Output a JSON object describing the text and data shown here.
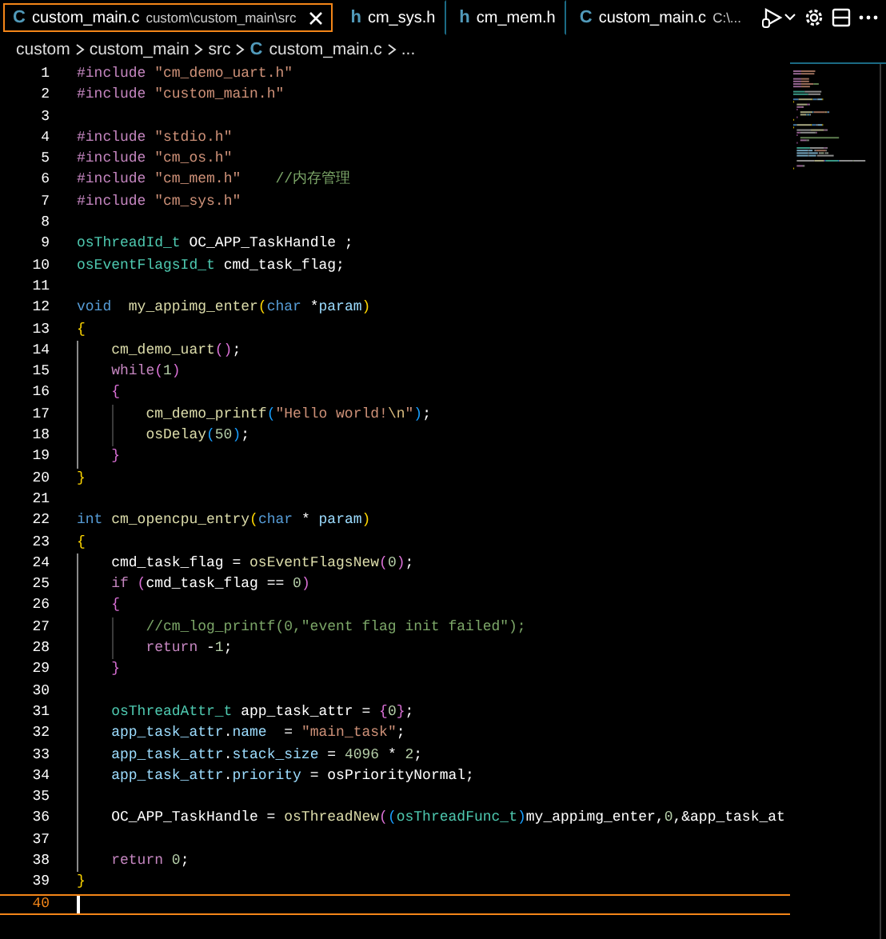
{
  "tabs": [
    {
      "icon": "C",
      "label": "custom_main.c",
      "description": "custom\\custom_main\\src",
      "selected": true
    },
    {
      "icon": "h",
      "label": "cm_sys.h",
      "selected": false
    },
    {
      "icon": "h",
      "label": "cm_mem.h",
      "selected": false
    },
    {
      "icon": "C",
      "label": "custom_main.c",
      "description": "C:\\...",
      "selected": false
    }
  ],
  "breadcrumb": [
    {
      "text": "custom"
    },
    {
      "text": "custom_main"
    },
    {
      "text": "src"
    },
    {
      "text": "custom_main.c",
      "icon": "C"
    },
    {
      "text": "..."
    }
  ],
  "lines": [
    {
      "number": "1",
      "current": false,
      "tokens": [
        {
          "kind": "preproc",
          "text": "#include "
        },
        {
          "kind": "string",
          "text": "\"cm_demo_uart.h\""
        }
      ]
    },
    {
      "number": "2",
      "current": false,
      "tokens": [
        {
          "kind": "preproc",
          "text": "#include "
        },
        {
          "kind": "string",
          "text": "\"custom_main.h\""
        }
      ]
    },
    {
      "number": "3",
      "current": false
    },
    {
      "number": "4",
      "current": false,
      "tokens": [
        {
          "kind": "preproc",
          "text": "#include "
        },
        {
          "kind": "string",
          "text": "\"stdio.h\""
        }
      ]
    },
    {
      "number": "5",
      "current": false,
      "tokens": [
        {
          "kind": "preproc",
          "text": "#include "
        },
        {
          "kind": "string",
          "text": "\"cm_os.h\""
        }
      ]
    },
    {
      "number": "6",
      "current": false,
      "tokens": [
        {
          "kind": "preproc",
          "text": "#include "
        },
        {
          "kind": "string",
          "text": "\"cm_mem.h\"    "
        },
        {
          "kind": "comment",
          "text": "//内存管理"
        }
      ]
    },
    {
      "number": "7",
      "current": false,
      "tokens": [
        {
          "kind": "preproc",
          "text": "#include "
        },
        {
          "kind": "string",
          "text": "\"cm_sys.h\""
        }
      ]
    },
    {
      "number": "8",
      "current": false
    },
    {
      "number": "9",
      "current": false,
      "tokens": [
        {
          "kind": "type",
          "text": "osThreadId_t "
        },
        {
          "kind": "plain",
          "text": "OC_APP_TaskHandle ;"
        }
      ]
    },
    {
      "number": "10",
      "current": false,
      "tokens": [
        {
          "kind": "type",
          "text": "osEventFlagsId_t "
        },
        {
          "kind": "plain",
          "text": "cmd_task_flag;"
        }
      ]
    },
    {
      "number": "11",
      "current": false
    },
    {
      "number": "12",
      "current": false,
      "tokens": [
        {
          "kind": "keyword",
          "text": "void  "
        },
        {
          "kind": "function",
          "text": "my_appimg_enter"
        },
        {
          "kind": "bracket1",
          "text": "("
        },
        {
          "kind": "keyword",
          "text": "char "
        },
        {
          "kind": "plain",
          "text": "*"
        },
        {
          "kind": "variable",
          "text": "param"
        },
        {
          "kind": "bracket1",
          "text": ")"
        }
      ]
    },
    {
      "number": "13",
      "current": false,
      "tokens": [
        {
          "kind": "bracket1",
          "text": "{"
        }
      ]
    },
    {
      "number": "14",
      "current": false,
      "tokens": [
        {
          "kind": "function",
          "text": "    cm_demo_uart"
        },
        {
          "kind": "bracket2",
          "text": "()"
        },
        {
          "kind": "plain",
          "text": ";"
        }
      ]
    },
    {
      "number": "15",
      "current": false,
      "tokens": [
        {
          "kind": "control",
          "text": "    while"
        },
        {
          "kind": "bracket2",
          "text": "("
        },
        {
          "kind": "number",
          "text": "1"
        },
        {
          "kind": "bracket2",
          "text": ")"
        }
      ]
    },
    {
      "number": "16",
      "current": false,
      "tokens": [
        {
          "kind": "bracket2",
          "text": "    {"
        }
      ]
    },
    {
      "number": "17",
      "current": false,
      "tokens": [
        {
          "kind": "function",
          "text": "        cm_demo_printf"
        },
        {
          "kind": "bracket3",
          "text": "("
        },
        {
          "kind": "string",
          "text": "\"Hello world!"
        },
        {
          "kind": "escape",
          "text": "\\n"
        },
        {
          "kind": "string",
          "text": "\""
        },
        {
          "kind": "bracket3",
          "text": ")"
        },
        {
          "kind": "plain",
          "text": ";"
        }
      ]
    },
    {
      "number": "18",
      "current": false,
      "tokens": [
        {
          "kind": "function",
          "text": "        osDelay"
        },
        {
          "kind": "bracket3",
          "text": "("
        },
        {
          "kind": "number",
          "text": "50"
        },
        {
          "kind": "bracket3",
          "text": ")"
        },
        {
          "kind": "plain",
          "text": ";"
        }
      ]
    },
    {
      "number": "19",
      "current": false,
      "tokens": [
        {
          "kind": "bracket2",
          "text": "    }"
        }
      ]
    },
    {
      "number": "20",
      "current": false,
      "tokens": [
        {
          "kind": "bracket1",
          "text": "}"
        }
      ]
    },
    {
      "number": "21",
      "current": false
    },
    {
      "number": "22",
      "current": false,
      "tokens": [
        {
          "kind": "keyword",
          "text": "int "
        },
        {
          "kind": "function",
          "text": "cm_opencpu_entry"
        },
        {
          "kind": "bracket1",
          "text": "("
        },
        {
          "kind": "keyword",
          "text": "char "
        },
        {
          "kind": "plain",
          "text": "* "
        },
        {
          "kind": "variable",
          "text": "param"
        },
        {
          "kind": "bracket1",
          "text": ")"
        }
      ]
    },
    {
      "number": "23",
      "current": false,
      "tokens": [
        {
          "kind": "bracket1",
          "text": "{"
        }
      ]
    },
    {
      "number": "24",
      "current": false,
      "tokens": [
        {
          "kind": "plain",
          "text": "    cmd_task_flag = "
        },
        {
          "kind": "function",
          "text": "osEventFlagsNew"
        },
        {
          "kind": "bracket2",
          "text": "("
        },
        {
          "kind": "number",
          "text": "0"
        },
        {
          "kind": "bracket2",
          "text": ")"
        },
        {
          "kind": "plain",
          "text": ";"
        }
      ]
    },
    {
      "number": "25",
      "current": false,
      "tokens": [
        {
          "kind": "control",
          "text": "    if "
        },
        {
          "kind": "bracket2",
          "text": "("
        },
        {
          "kind": "plain",
          "text": "cmd_task_flag == "
        },
        {
          "kind": "number",
          "text": "0"
        },
        {
          "kind": "bracket2",
          "text": ")"
        }
      ]
    },
    {
      "number": "26",
      "current": false,
      "tokens": [
        {
          "kind": "bracket2",
          "text": "    {"
        }
      ]
    },
    {
      "number": "27",
      "current": false,
      "tokens": [
        {
          "kind": "comment",
          "text": "        //cm_log_printf(0,\"event flag init failed\");"
        }
      ]
    },
    {
      "number": "28",
      "current": false,
      "tokens": [
        {
          "kind": "control",
          "text": "        return "
        },
        {
          "kind": "plain",
          "text": "-"
        },
        {
          "kind": "number",
          "text": "1"
        },
        {
          "kind": "plain",
          "text": ";"
        }
      ]
    },
    {
      "number": "29",
      "current": false,
      "tokens": [
        {
          "kind": "bracket2",
          "text": "    }"
        }
      ]
    },
    {
      "number": "30",
      "current": false
    },
    {
      "number": "31",
      "current": false,
      "tokens": [
        {
          "kind": "type",
          "text": "    osThreadAttr_t "
        },
        {
          "kind": "plain",
          "text": "app_task_attr = "
        },
        {
          "kind": "bracket2",
          "text": "{"
        },
        {
          "kind": "number",
          "text": "0"
        },
        {
          "kind": "bracket2",
          "text": "}"
        },
        {
          "kind": "plain",
          "text": ";"
        }
      ]
    },
    {
      "number": "32",
      "current": false,
      "tokens": [
        {
          "kind": "variable",
          "text": "    app_task_attr"
        },
        {
          "kind": "plain",
          "text": "."
        },
        {
          "kind": "variable",
          "text": "name"
        },
        {
          "kind": "plain",
          "text": "  = "
        },
        {
          "kind": "string",
          "text": "\"main_task\""
        },
        {
          "kind": "plain",
          "text": ";"
        }
      ]
    },
    {
      "number": "33",
      "current": false,
      "tokens": [
        {
          "kind": "variable",
          "text": "    app_task_attr"
        },
        {
          "kind": "plain",
          "text": "."
        },
        {
          "kind": "variable",
          "text": "stack_size"
        },
        {
          "kind": "plain",
          "text": " = "
        },
        {
          "kind": "number",
          "text": "4096"
        },
        {
          "kind": "plain",
          "text": " * "
        },
        {
          "kind": "number",
          "text": "2"
        },
        {
          "kind": "plain",
          "text": ";"
        }
      ]
    },
    {
      "number": "34",
      "current": false,
      "tokens": [
        {
          "kind": "variable",
          "text": "    app_task_attr"
        },
        {
          "kind": "plain",
          "text": "."
        },
        {
          "kind": "variable",
          "text": "priority"
        },
        {
          "kind": "plain",
          "text": " = osPriorityNormal;"
        }
      ]
    },
    {
      "number": "35",
      "current": false
    },
    {
      "number": "36",
      "current": false,
      "tokens": [
        {
          "kind": "plain",
          "text": "    OC_APP_TaskHandle = "
        },
        {
          "kind": "function",
          "text": "osThreadNew"
        },
        {
          "kind": "bracket2",
          "text": "("
        },
        {
          "kind": "bracket3",
          "text": "("
        },
        {
          "kind": "type",
          "text": "osThreadFunc_t"
        },
        {
          "kind": "bracket3",
          "text": ")"
        },
        {
          "kind": "plain",
          "text": "my_appimg_enter,"
        },
        {
          "kind": "number",
          "text": "0"
        },
        {
          "kind": "plain",
          "text": ",&app_task_at"
        }
      ]
    },
    {
      "number": "37",
      "current": false
    },
    {
      "number": "38",
      "current": false,
      "tokens": [
        {
          "kind": "control",
          "text": "    return "
        },
        {
          "kind": "number",
          "text": "0"
        },
        {
          "kind": "plain",
          "text": ";"
        }
      ]
    },
    {
      "number": "39",
      "current": false,
      "tokens": [
        {
          "kind": "bracket1",
          "text": "}"
        }
      ]
    },
    {
      "number": "40",
      "current": true
    }
  ]
}
